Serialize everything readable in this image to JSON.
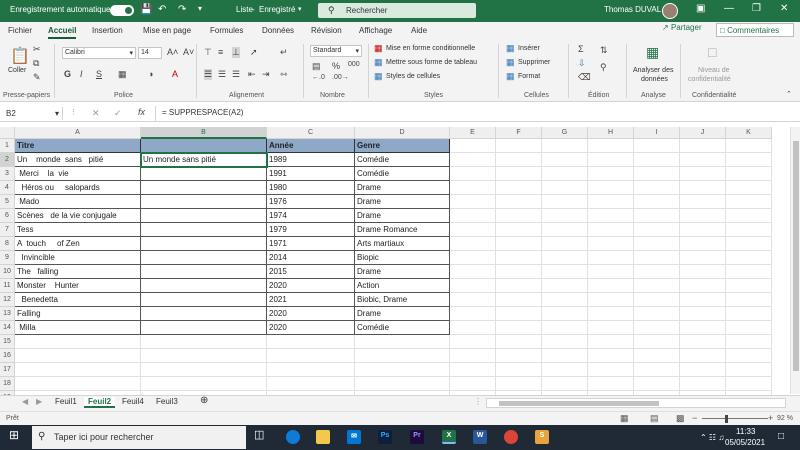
{
  "titlebar": {
    "autosave_label": "Enregistrement automatique",
    "autosave_state": "on",
    "file_title": "Liste",
    "save_status": "Enregistré",
    "search_placeholder": "Rechercher",
    "user_name": "Thomas DUVAL"
  },
  "menu": {
    "tabs": [
      "Fichier",
      "Accueil",
      "Insertion",
      "Mise en page",
      "Formules",
      "Données",
      "Révision",
      "Affichage",
      "Aide"
    ],
    "active_tab": "Accueil",
    "share_label": "Partager",
    "comments_label": "Commentaires"
  },
  "ribbon": {
    "clipboard": {
      "paste_label": "Coller",
      "group": "Presse-papiers"
    },
    "font": {
      "name": "Calibri",
      "size": "14",
      "bold": "G",
      "italic": "I",
      "underline": "S",
      "group": "Police"
    },
    "alignment": {
      "group": "Alignement"
    },
    "number": {
      "format": "Standard",
      "group": "Nombre",
      "percent": "%",
      "thousands": "000"
    },
    "styles": {
      "conditional": "Mise en forme conditionnelle",
      "table": "Mettre sous forme de tableau",
      "cell_styles": "Styles de cellules",
      "group": "Styles"
    },
    "cells": {
      "insert": "Insérer",
      "delete": "Supprimer",
      "format": "Format",
      "group": "Cellules"
    },
    "editing": {
      "group": "Édition"
    },
    "analysis": {
      "label_line1": "Analyser des",
      "label_line2": "données",
      "group": "Analyse"
    },
    "sensitivity": {
      "label_line1": "Niveau de",
      "label_line2": "confidentialité",
      "group": "Confidentialité"
    }
  },
  "formula_bar": {
    "name_box": "B2",
    "fx": "fx",
    "formula": "= SUPPRESPACE(A2)"
  },
  "columns": [
    "A",
    "B",
    "C",
    "D",
    "E",
    "F",
    "G",
    "H",
    "I",
    "J",
    "K"
  ],
  "selected_column": "B",
  "rows": [
    "1",
    "2",
    "3",
    "4",
    "5",
    "6",
    "7",
    "8",
    "9",
    "10",
    "11",
    "12",
    "13",
    "14",
    "15",
    "16",
    "17",
    "18",
    "19"
  ],
  "selected_row": "2",
  "table": {
    "headers": [
      "Titre",
      "",
      "Année",
      "Genre"
    ],
    "rows": [
      [
        "Un    monde  sans   pitié",
        "Un monde sans pitié",
        "1989",
        "Comédie"
      ],
      [
        " Merci    la  vie",
        "",
        "1991",
        "Comédie"
      ],
      [
        "  Héros ou     salopards",
        "",
        "1980",
        "Drame"
      ],
      [
        " Mado",
        "",
        "1976",
        "Drame"
      ],
      [
        "Scènes   de la vie conjugale",
        "",
        "1974",
        "Drame"
      ],
      [
        "Tess",
        "",
        "1979",
        "Drame Romance"
      ],
      [
        "A  touch     of Zen",
        "",
        "1971",
        "Arts martiaux"
      ],
      [
        "  Invincible",
        "",
        "2014",
        "Biopic"
      ],
      [
        "The   falling",
        "",
        "2015",
        "Drame"
      ],
      [
        "Monster    Hunter",
        "",
        "2020",
        "Action"
      ],
      [
        "  Benedetta",
        "",
        "2021",
        "Biobic, Drame"
      ],
      [
        "Falling",
        "",
        "2020",
        "Drame"
      ],
      [
        " Milla",
        "",
        "2020",
        "Comédie"
      ]
    ]
  },
  "sheets": {
    "tabs": [
      "Feuil1",
      "Feuil2",
      "Feuil4",
      "Feuil3"
    ],
    "active": "Feuil2"
  },
  "status": {
    "mode": "Prêt",
    "zoom": "92 %"
  },
  "taskbar": {
    "search_placeholder": "Taper ici pour rechercher",
    "time": "11:33",
    "date": "05/05/2021"
  },
  "colors": {
    "excel_green": "#217346",
    "header_fill": "#8ea9c8",
    "taskbar": "#1f2a36"
  }
}
